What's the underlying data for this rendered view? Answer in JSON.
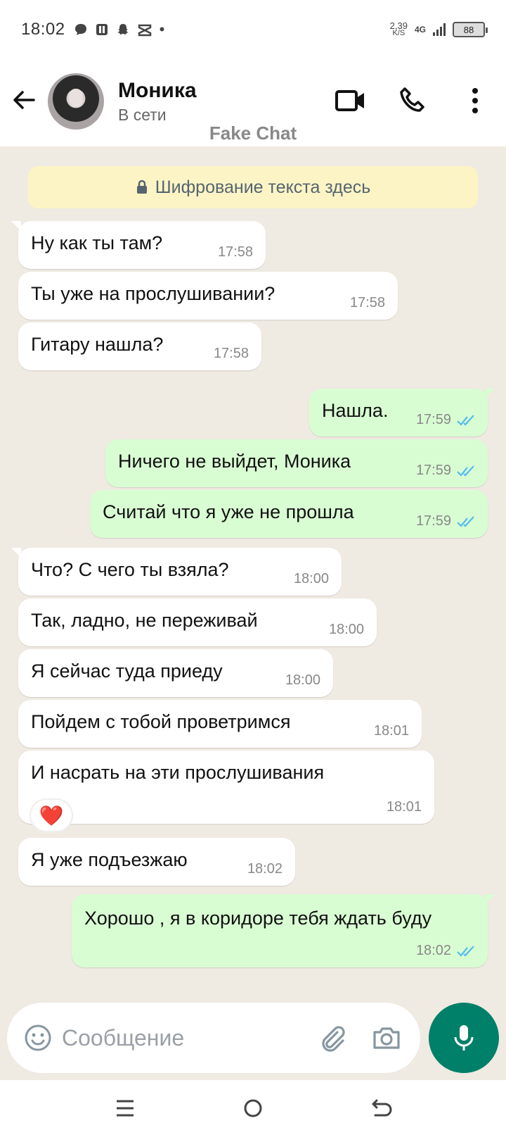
{
  "status_bar": {
    "time": "18:02",
    "net_speed_value": "2,39",
    "net_speed_unit": "K/S",
    "network_type": "4G",
    "battery": "88",
    "notification_icons": [
      "message-icon",
      "mirror-icon",
      "snapchat-icon",
      "capcut-icon",
      "more-dot-icon"
    ]
  },
  "header": {
    "contact_name": "Моника",
    "contact_status": "В сети",
    "watermark": "Fake Chat"
  },
  "encryption_notice": "Шифрование текста здесь",
  "messages": [
    {
      "dir": "in",
      "text": "Ну как ты там?",
      "time": "17:58"
    },
    {
      "dir": "in",
      "text": "Ты уже на прослушивании?",
      "time": "17:58"
    },
    {
      "dir": "in",
      "text": "Гитару нашла?",
      "time": "17:58"
    },
    {
      "dir": "out",
      "text": "Нашла.",
      "time": "17:59",
      "read": true
    },
    {
      "dir": "out",
      "text": "Ничего не выйдет, Моника",
      "time": "17:59",
      "read": true
    },
    {
      "dir": "out",
      "text": "Считай что я уже не прошла",
      "time": "17:59",
      "read": true
    },
    {
      "dir": "in",
      "text": "Что? С чего ты взяла?",
      "time": "18:00"
    },
    {
      "dir": "in",
      "text": "Так, ладно, не переживай",
      "time": "18:00"
    },
    {
      "dir": "in",
      "text": "Я сейчас туда приеду",
      "time": "18:00"
    },
    {
      "dir": "in",
      "text": "Пойдем с тобой проветримся",
      "time": "18:01"
    },
    {
      "dir": "in",
      "text": "И насрать на эти прослушивания",
      "time": "18:01",
      "reaction": "❤️"
    },
    {
      "dir": "in",
      "text": "Я уже подъезжаю",
      "time": "18:02"
    },
    {
      "dir": "out",
      "text": "Хорошо , я в коридоре тебя ждать буду",
      "time": "18:02",
      "read": true
    }
  ],
  "composer": {
    "placeholder": "Сообщение",
    "value": ""
  },
  "colors": {
    "accent": "#008069",
    "outgoing_bubble": "#d9fdd3",
    "incoming_bubble": "#ffffff",
    "chat_background": "#efeae2",
    "read_ticks": "#53bdeb",
    "encryption_banner": "#fdf4c5"
  }
}
